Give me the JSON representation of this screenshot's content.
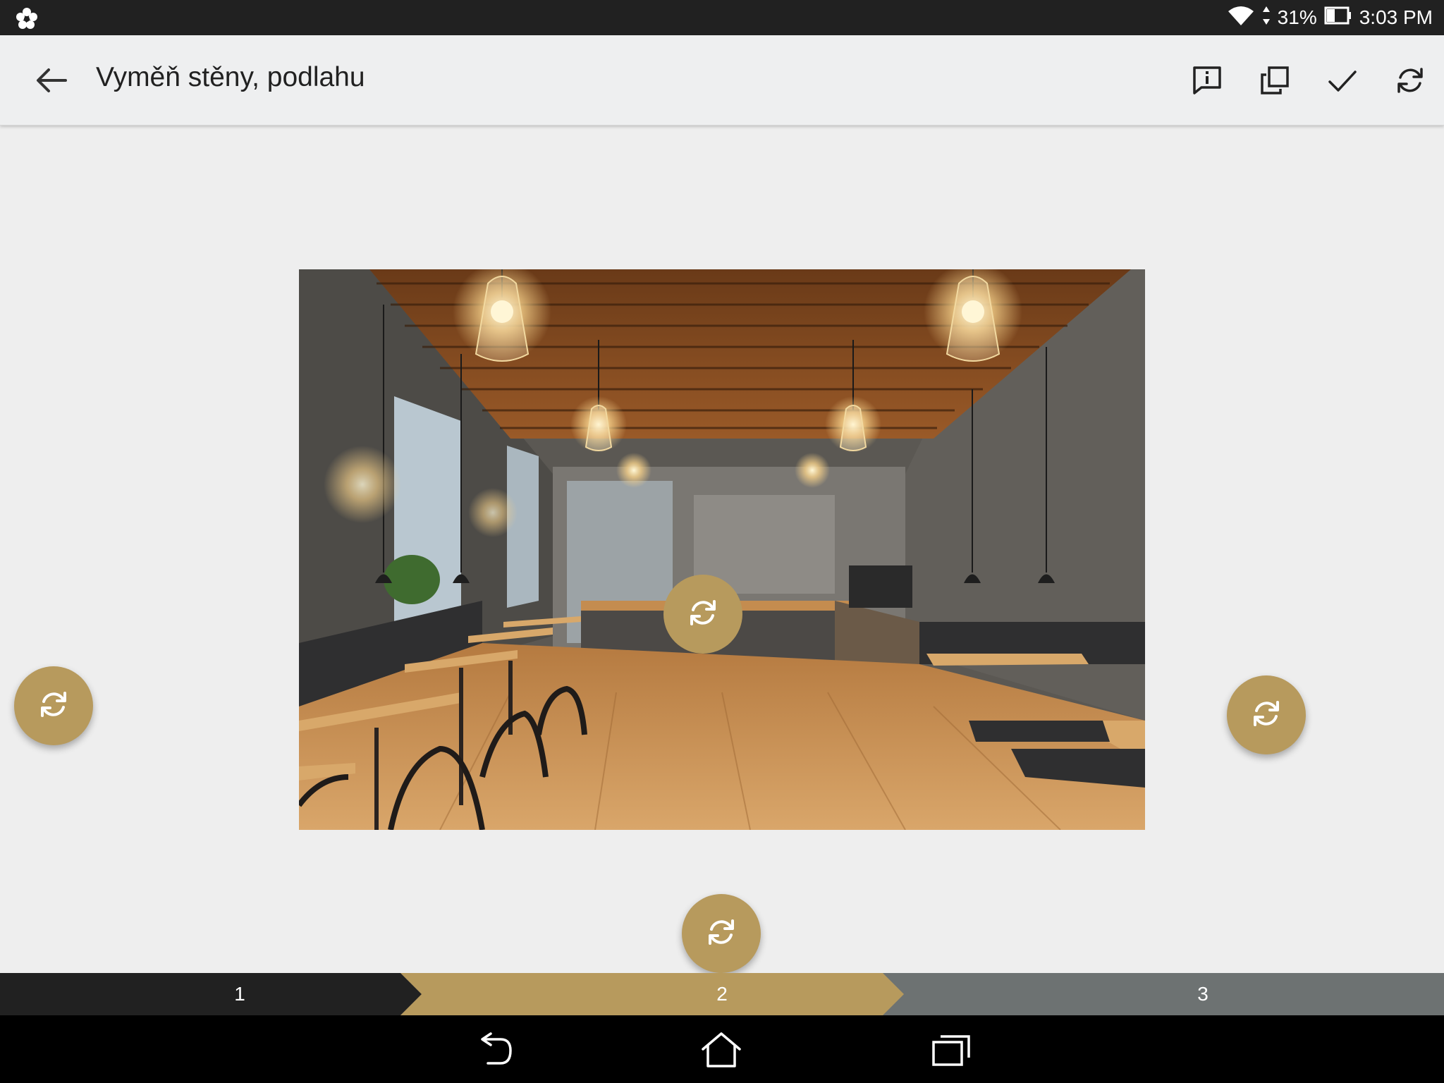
{
  "status_bar": {
    "battery_text": "31%",
    "time": "3:03 PM",
    "app_icon": "flower-icon",
    "wifi_icon": "wifi-icon",
    "battery_icon": "battery-icon"
  },
  "app_bar": {
    "title": "Vyměň stěny, podlahu",
    "back_icon": "arrow-back-icon",
    "actions": [
      {
        "icon": "info-comment-icon"
      },
      {
        "icon": "copy-icon"
      },
      {
        "icon": "check-icon"
      },
      {
        "icon": "refresh-icon"
      }
    ]
  },
  "photo": {
    "description_icon": "cafe-interior-image"
  },
  "fabs": {
    "icon": "swap-refresh-icon",
    "accent_color": "#b79a5d"
  },
  "steps": {
    "items": [
      {
        "label": "1",
        "color": "#212121"
      },
      {
        "label": "2",
        "color": "#b79a5d"
      },
      {
        "label": "3",
        "color": "#6d7272"
      }
    ],
    "current": "2"
  },
  "nav_bar": {
    "back_icon": "nav-back-icon",
    "home_icon": "nav-home-icon",
    "recents_icon": "nav-recents-icon"
  }
}
